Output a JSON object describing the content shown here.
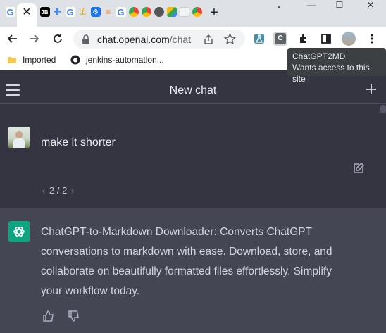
{
  "browser": {
    "tab_close_glyph": "✕",
    "new_tab_glyph": "+",
    "window_controls": {
      "minimize": "—",
      "maximize": "☐",
      "close": "✕"
    },
    "url_host": "chat.openai.com",
    "url_path": "/chat",
    "bookmarks": [
      {
        "label": "Imported",
        "icon": "folder-icon"
      },
      {
        "label": "jenkins-automation...",
        "icon": "github-icon"
      }
    ],
    "tooltip": {
      "title": "ChatGPT2MD",
      "subtitle": "Wants access to this site"
    }
  },
  "chat": {
    "header_title": "New chat",
    "user_message": "make it shorter",
    "pager": {
      "current": "2 / 2"
    },
    "assistant_message": "ChatGPT-to-Markdown Downloader: Converts ChatGPT conversations to markdown with ease. Download, store, and collaborate on beautifully formatted files effortlessly. Simplify your workflow today."
  },
  "colors": {
    "chat_bg": "#343541",
    "assistant_bg": "#444654",
    "openai_green": "#10a37f"
  }
}
